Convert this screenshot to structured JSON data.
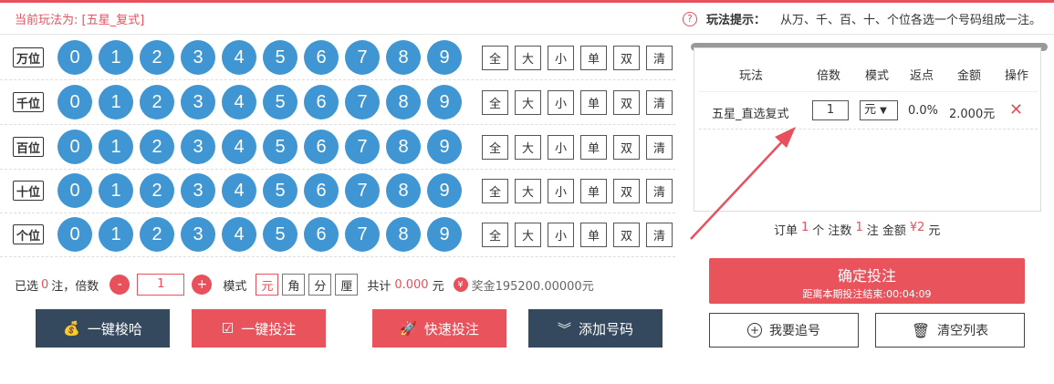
{
  "header": {
    "current_play": "当前玩法为: [五星_复式]",
    "hint_icon": "question-icon",
    "hint_title": "玩法提示：",
    "hint_text": "从万、千、百、十、个位各选一个号码组成一注。"
  },
  "rows": [
    {
      "label": "万位"
    },
    {
      "label": "千位"
    },
    {
      "label": "百位"
    },
    {
      "label": "十位"
    },
    {
      "label": "个位"
    }
  ],
  "digits": [
    "0",
    "1",
    "2",
    "3",
    "4",
    "5",
    "6",
    "7",
    "8",
    "9"
  ],
  "quick": [
    "全",
    "大",
    "小",
    "单",
    "双",
    "清"
  ],
  "bottom": {
    "selected_prefix": "已选",
    "selected_count": "0",
    "selected_suffix": "注，倍数",
    "minus": "-",
    "multiple": "1",
    "plus": "+",
    "mode_label": "模式",
    "modes": [
      "元",
      "角",
      "分",
      "厘"
    ],
    "total_label": "共计",
    "total_value": "0.000",
    "total_unit": "元",
    "prize_icon": "¥",
    "prize_text": "奖金195200.00000元"
  },
  "actions": {
    "random": "一键梭哈",
    "bet": "一键投注",
    "fast": "快速投注",
    "add": "添加号码"
  },
  "cart": {
    "headers": [
      "玩法",
      "倍数",
      "模式",
      "返点",
      "金额",
      "操作"
    ],
    "row": {
      "play": "五星_直选复式",
      "multiple": "1",
      "mode": "元",
      "rebate": "0.0%",
      "amount": "2.000元",
      "delete": "✕"
    },
    "summary": {
      "order_label": "订单",
      "order_count": "1",
      "count_label": "个 注数",
      "bet_count": "1",
      "amount_label": "注 金额",
      "amount": "¥2",
      "unit": "元"
    }
  },
  "confirm": {
    "title": "确定投注",
    "countdown": "距离本期投注结束:00:04:09"
  },
  "side_buttons": {
    "chase": "我要追号",
    "clear": "清空列表"
  }
}
